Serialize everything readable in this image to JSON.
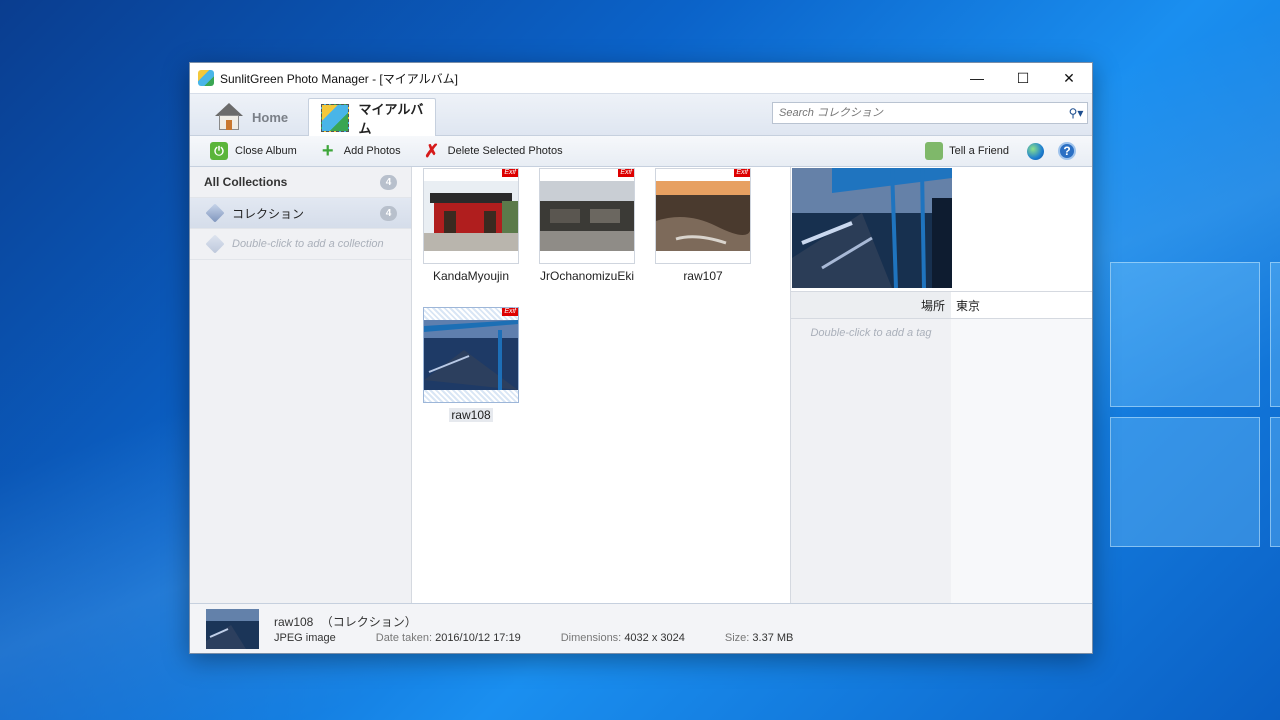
{
  "window": {
    "title": "SunlitGreen Photo Manager - [マイアルバム]"
  },
  "tabs": {
    "home_label": "Home",
    "album_label": "マイアルバム"
  },
  "search": {
    "placeholder": "Search コレクション"
  },
  "toolbar": {
    "close_album": "Close Album",
    "add_photos": "Add Photos",
    "delete_selected": "Delete Selected Photos",
    "tell_friend": "Tell a Friend"
  },
  "sidebar": {
    "all_collections_label": "All Collections",
    "all_collections_count": "4",
    "collection_label": "コレクション",
    "collection_count": "4",
    "add_collection_hint": "Double-click to add a collection"
  },
  "photos": [
    {
      "name": "KandaMyoujin",
      "exif": "Exif"
    },
    {
      "name": "JrOchanomizuEki",
      "exif": "Exif"
    },
    {
      "name": "raw107",
      "exif": "Exif"
    },
    {
      "name": "raw108",
      "exif": "Exif"
    }
  ],
  "detail": {
    "meta_key": "場所",
    "meta_value": "東京",
    "tag_hint": "Double-click to add a tag"
  },
  "status": {
    "name": "raw108",
    "collection": "（コレクション）",
    "type": "JPEG image",
    "date_label": "Date taken:",
    "date_value": "2016/10/12 17:19",
    "dim_label": "Dimensions:",
    "dim_value": "4032 x 3024",
    "size_label": "Size:",
    "size_value": "3.37 MB"
  }
}
